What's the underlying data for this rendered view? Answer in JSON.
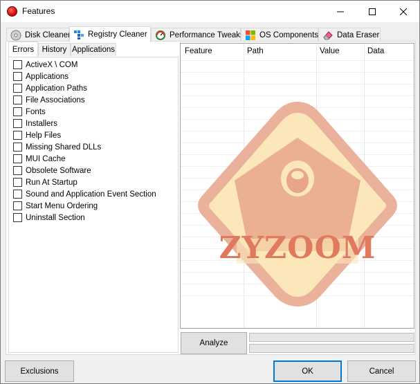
{
  "window": {
    "title": "Features",
    "minimize": "—",
    "maximize": "☐",
    "close": "✕"
  },
  "main_tabs": [
    {
      "label": "Disk Cleaner",
      "icon": "disk-icon"
    },
    {
      "label": "Registry Cleaner",
      "icon": "registry-icon",
      "active": true
    },
    {
      "label": "Performance Tweaks",
      "icon": "speedometer-icon"
    },
    {
      "label": "OS Components",
      "icon": "windows-logo-icon"
    },
    {
      "label": "Data Eraser",
      "icon": "eraser-icon"
    }
  ],
  "sub_tabs": [
    {
      "label": "Errors",
      "active": true
    },
    {
      "label": "History"
    },
    {
      "label": "Applications"
    }
  ],
  "error_items": [
    {
      "label": "ActiveX \\ COM",
      "checked": false
    },
    {
      "label": "Applications",
      "checked": false
    },
    {
      "label": "Application Paths",
      "checked": false
    },
    {
      "label": "File Associations",
      "checked": false
    },
    {
      "label": "Fonts",
      "checked": false
    },
    {
      "label": "Installers",
      "checked": false
    },
    {
      "label": "Help Files",
      "checked": false
    },
    {
      "label": "Missing Shared DLLs",
      "checked": false
    },
    {
      "label": "MUI Cache",
      "checked": false
    },
    {
      "label": "Obsolete Software",
      "checked": false
    },
    {
      "label": "Run At Startup",
      "checked": false
    },
    {
      "label": "Sound and Application Event Section",
      "checked": false
    },
    {
      "label": "Start Menu Ordering",
      "checked": false
    },
    {
      "label": "Uninstall Section",
      "checked": false
    }
  ],
  "grid": {
    "columns": [
      "Feature",
      "Path",
      "Value",
      "Data"
    ],
    "rows": []
  },
  "watermark_text": "ZYZOOM",
  "analyze_label": "Analyze",
  "progress": [
    0,
    0
  ],
  "buttons": {
    "exclusions": "Exclusions",
    "ok": "OK",
    "cancel": "Cancel"
  },
  "colors": {
    "accent": "#0078d7",
    "watermark_fill": "#fbe7b9",
    "watermark_stroke": "#e8a58a",
    "watermark_text": "#e07a5f"
  }
}
